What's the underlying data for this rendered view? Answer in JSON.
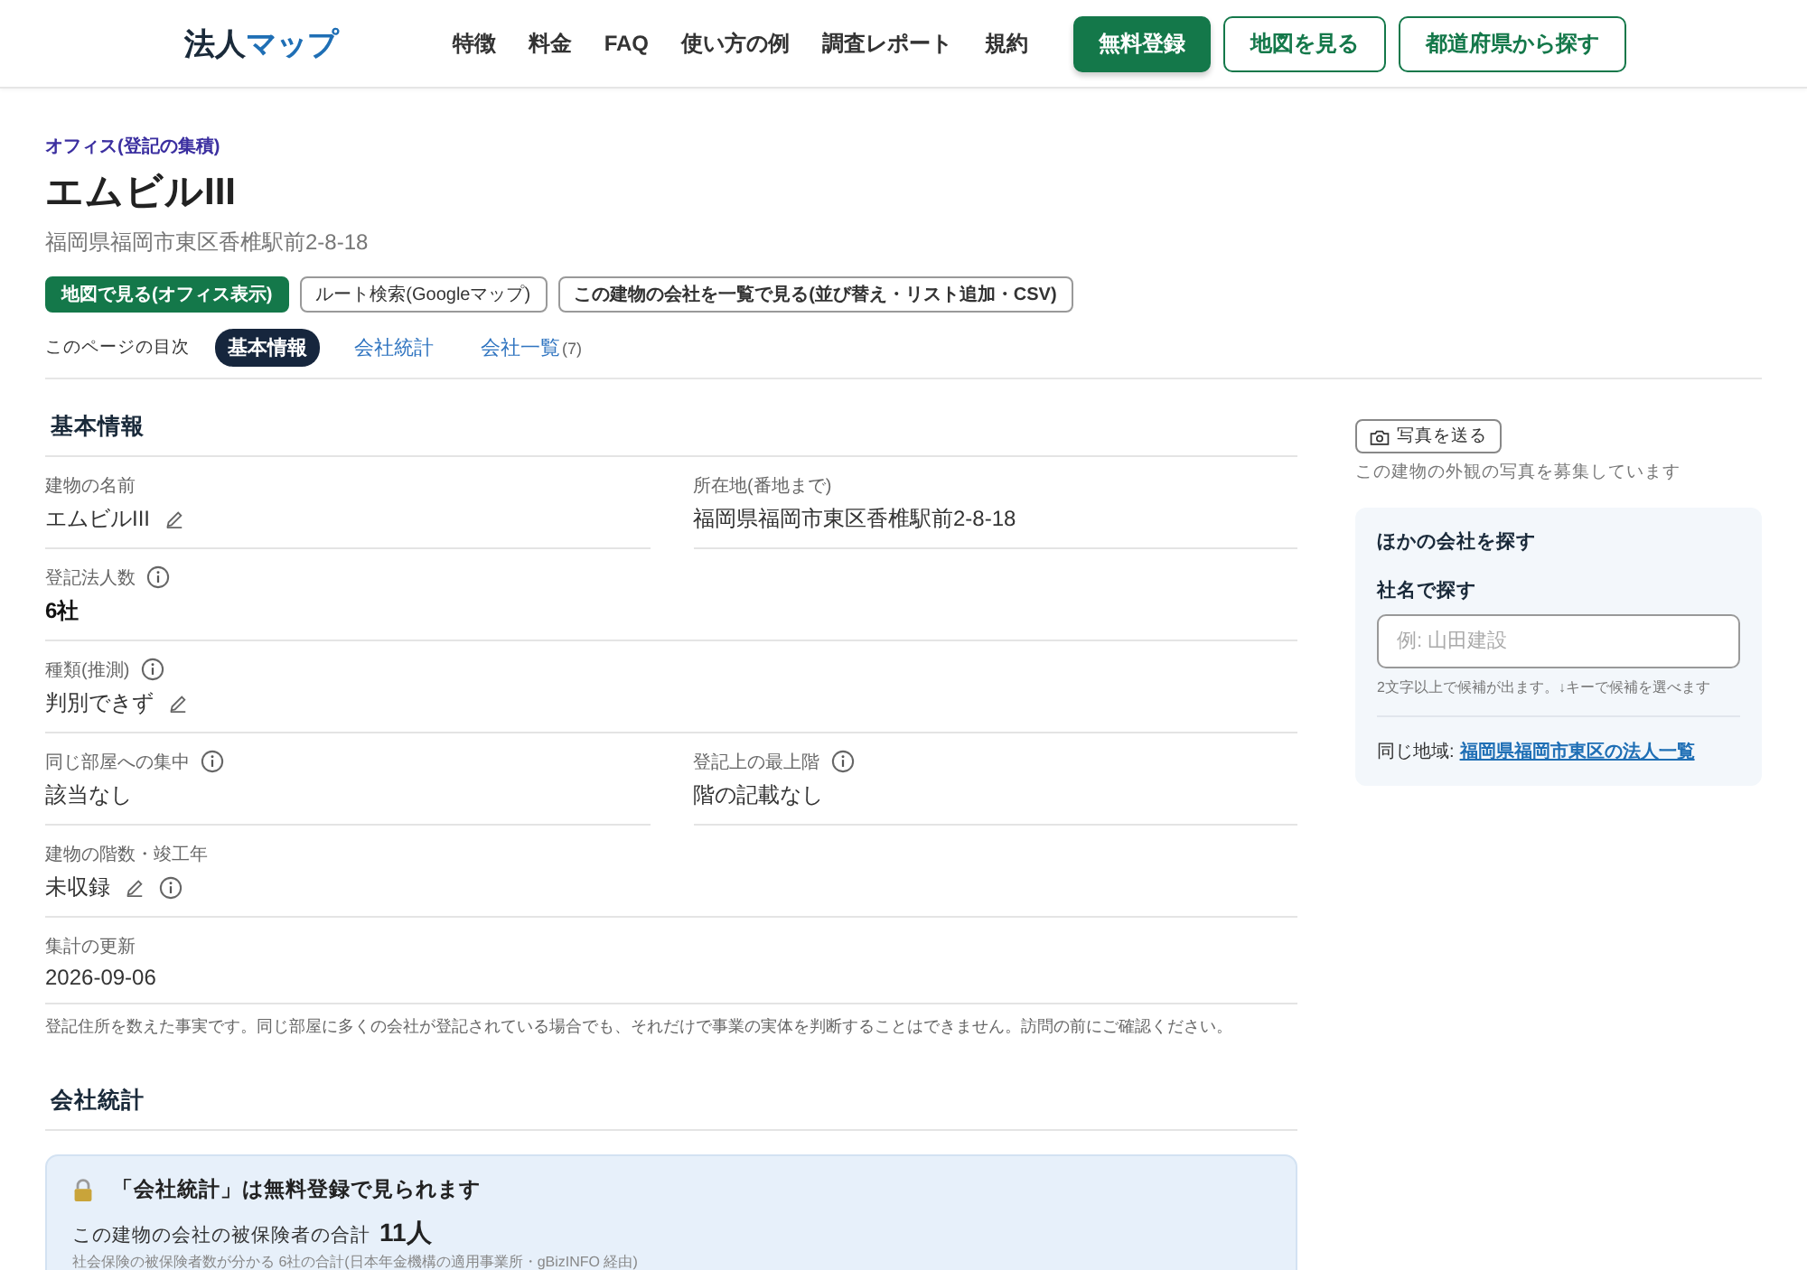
{
  "header": {
    "logo_main": "法人",
    "logo_accent": "マップ",
    "nav": [
      "特徴",
      "料金",
      "FAQ",
      "使い方の例",
      "調査レポート",
      "規約"
    ],
    "buttons": [
      {
        "label": "無料登録",
        "kind": "primary"
      },
      {
        "label": "地図を見る",
        "kind": "outline"
      },
      {
        "label": "都道府県から探す",
        "kind": "outline"
      }
    ]
  },
  "category": "オフィス(登記の集積)",
  "title": "エムビルIII",
  "address": "福岡県福岡市東区香椎駅前2-8-18",
  "actions": [
    {
      "label": "地図で見る(オフィス表示)",
      "kind": "primary"
    },
    {
      "label": "ルート検索(Googleマップ)",
      "kind": "plain"
    },
    {
      "label": "この建物の会社を一覧で見る(並び替え・リスト追加・CSV)",
      "kind": "strong"
    }
  ],
  "toc": {
    "label": "このページの目次",
    "items": [
      {
        "label": "基本情報",
        "selected": true
      },
      {
        "label": "会社統計",
        "selected": false
      },
      {
        "label": "会社一覧",
        "count": "(7)",
        "selected": false
      }
    ]
  },
  "basic": {
    "heading": "基本情報",
    "rows": [
      [
        {
          "label": "建物の名前",
          "value": "エムビルIII",
          "editable": true
        },
        {
          "label": "所在地(番地まで)",
          "value": "福岡県福岡市東区香椎駅前2-8-18"
        }
      ],
      [
        {
          "label": "登記法人数",
          "value": "6社",
          "label_info": true,
          "strong": true
        }
      ],
      [
        {
          "label": "種類(推測)",
          "value": "判別できず",
          "label_info": true,
          "editable": true
        }
      ],
      [
        {
          "label": "同じ部屋への集中",
          "value": "該当なし",
          "label_info": true
        },
        {
          "label": "登記上の最上階",
          "value": "階の記載なし",
          "label_info": true
        }
      ],
      [
        {
          "label": "建物の階数・竣工年",
          "value": "未収録",
          "value_info": true,
          "editable": true
        }
      ],
      [
        {
          "label": "集計の更新",
          "value": "2026-09-06"
        }
      ]
    ],
    "note": "登記住所を数えた事実です。同じ部屋に多くの会社が登記されている場合でも、それだけで事業の実体を判断することはできません。訪問の前にご確認ください。"
  },
  "stats": {
    "heading": "会社統計",
    "lock_title": "「会社統計」は無料登録で見られます",
    "total_label": "この建物の会社の被保険者の合計",
    "total_value": "11人",
    "source": "社会保険の被保険者数が分かる 6社の合計(日本年金機構の適用事業所・gBizINFO 経由)"
  },
  "sidebar": {
    "photo_button": "写真を送る",
    "photo_note": "この建物の外観の写真を募集しています",
    "card_title": "ほかの会社を探す",
    "search_label": "社名で探す",
    "placeholder": "例: 山田建設",
    "hint": "2文字以上で候補が出ます。↓キーで候補を選べます",
    "region_label": "同じ地域:",
    "region_link": "福岡県福岡市東区の法人一覧"
  }
}
